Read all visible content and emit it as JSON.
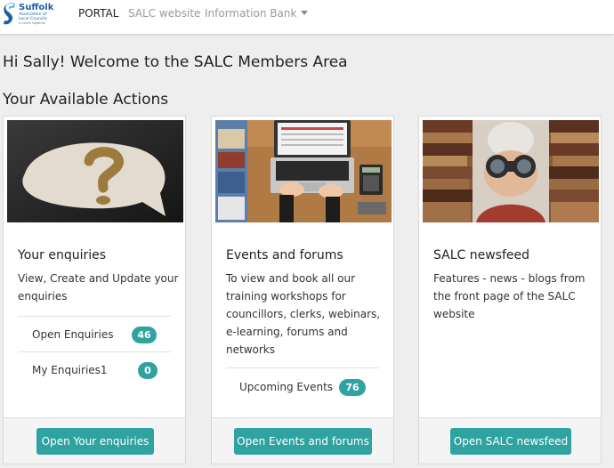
{
  "header": {
    "logo": {
      "title": "Suffolk",
      "subtitle_1": "Association of",
      "subtitle_2": "Local Councils",
      "tagline": "in touch together"
    },
    "nav": [
      {
        "label": "PORTAL",
        "active": true
      },
      {
        "label": "SALC website",
        "active": false
      },
      {
        "label": "Information Bank",
        "active": false,
        "dropdown": true
      }
    ]
  },
  "greeting": "Hi Sally! Welcome to the SALC Members Area",
  "section_title": "Your Available Actions",
  "accent_color": "#2fa3a0",
  "cards": [
    {
      "title": "Your enquiries",
      "description": "View, Create and Update your enquiries",
      "stats": [
        {
          "label": "Open Enquiries",
          "count": "46"
        },
        {
          "label": "My Enquiries1",
          "count": "0"
        }
      ],
      "button": "Open Your enquiries"
    },
    {
      "title": "Events and forums",
      "description": "To view and book all our training workshops for councillors, clerks, webinars, e-learning, forums and networks",
      "stats": [
        {
          "label": "Upcoming Events",
          "count": "76"
        }
      ],
      "button": "Open Events and forums"
    },
    {
      "title": "SALC newsfeed",
      "description": "Features - news - blogs from the front page of the SALC website",
      "stats": [],
      "button": "Open SALC newsfeed"
    }
  ]
}
